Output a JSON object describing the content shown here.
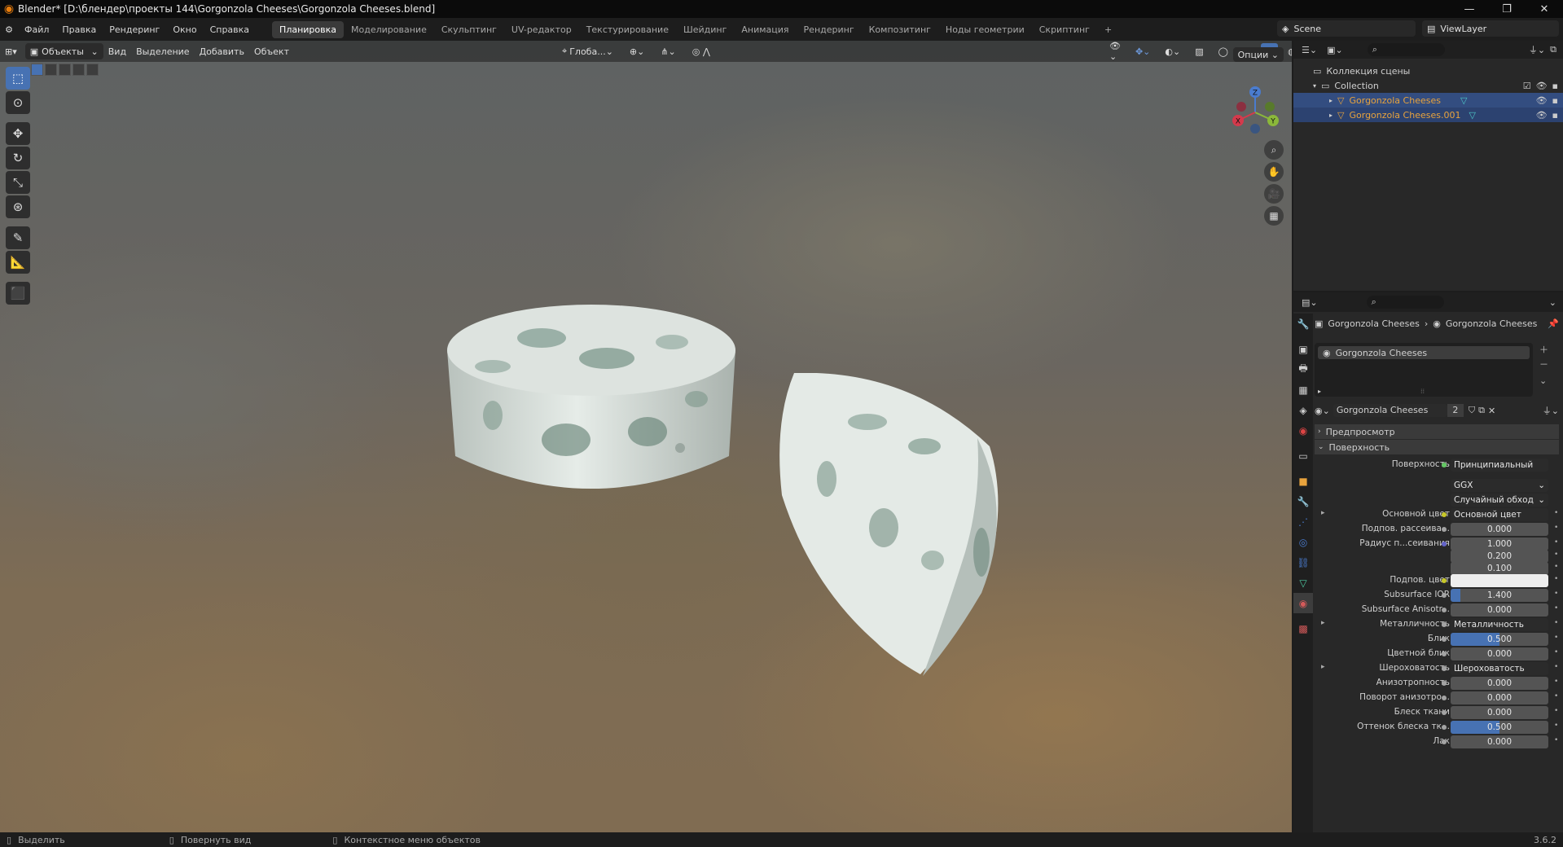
{
  "window": {
    "title": "Blender* [D:\\блендер\\проекты 144\\Gorgonzola Cheeses\\Gorgonzola Cheeses.blend]",
    "controls": [
      "—",
      "❐",
      "✕"
    ]
  },
  "menu": {
    "items": [
      "Файл",
      "Правка",
      "Рендеринг",
      "Окно",
      "Справка"
    ],
    "workspaces": [
      "Планировка",
      "Моделирование",
      "Скульптинг",
      "UV-редактор",
      "Текстурирование",
      "Шейдинг",
      "Анимация",
      "Рендеринг",
      "Композитинг",
      "Ноды геометрии",
      "Скриптинг"
    ],
    "active_workspace": "Планировка",
    "add_tab": "+",
    "scene": "Scene",
    "view_layer": "ViewLayer"
  },
  "viewport": {
    "mode": "Объекты",
    "menus": [
      "Вид",
      "Выделение",
      "Добавить",
      "Объект"
    ],
    "transform_orientation": "Глоба...",
    "options": "Опции",
    "gizmo": {
      "x": "X",
      "y": "Y",
      "z": "Z"
    }
  },
  "outliner": {
    "scene_collection": "Коллекция сцены",
    "collection": "Collection",
    "objects": [
      "Gorgonzola Cheeses",
      "Gorgonzola Cheeses.001"
    ]
  },
  "properties": {
    "breadcrumb": [
      "Gorgonzola Cheeses",
      "Gorgonzola Cheeses"
    ],
    "material_slot": "Gorgonzola Cheeses",
    "material_name": "Gorgonzola Cheeses",
    "user_count": "2",
    "sections": {
      "preview": "Предпросмотр",
      "surface": "Поверхность"
    },
    "surface_label": "Поверхность",
    "surface_value": "Принципиальный BSDF",
    "distribution": "GGX",
    "subsurface_method": "Случайный обход",
    "rows": [
      {
        "label": "Основной цвет",
        "value": "Основной цвет",
        "kind": "link",
        "dot": "yel"
      },
      {
        "label": "Подпов. рассеива...",
        "value": "0.000",
        "kind": "num",
        "dot": "grey",
        "fill": 0
      },
      {
        "label": "Радиус п...сеивания",
        "value": "1.000",
        "kind": "num",
        "dot": "blue",
        "fill": 0
      },
      {
        "label": "",
        "value": "0.200",
        "kind": "num",
        "dot": "",
        "fill": 0
      },
      {
        "label": "",
        "value": "0.100",
        "kind": "num",
        "dot": "",
        "fill": 0
      },
      {
        "label": "Подпов. цвет",
        "value": "",
        "kind": "color",
        "dot": "yel"
      },
      {
        "label": "Subsurface IOR",
        "value": "1.400",
        "kind": "num",
        "dot": "grey",
        "fill": 0.1
      },
      {
        "label": "Subsurface Anisotr...",
        "value": "0.000",
        "kind": "num",
        "dot": "grey",
        "fill": 0
      },
      {
        "label": "Металличность",
        "value": "Металличность",
        "kind": "link",
        "dot": "grey"
      },
      {
        "label": "Блик",
        "value": "0.500",
        "kind": "num",
        "dot": "grey",
        "fill": 0.5
      },
      {
        "label": "Цветной блик",
        "value": "0.000",
        "kind": "num",
        "dot": "grey",
        "fill": 0
      },
      {
        "label": "Шероховатость",
        "value": "Шероховатость",
        "kind": "link",
        "dot": "grey"
      },
      {
        "label": "Анизотропность",
        "value": "0.000",
        "kind": "num",
        "dot": "grey",
        "fill": 0
      },
      {
        "label": "Поворот анизотро...",
        "value": "0.000",
        "kind": "num",
        "dot": "grey",
        "fill": 0
      },
      {
        "label": "Блеск ткани",
        "value": "0.000",
        "kind": "num",
        "dot": "grey",
        "fill": 0
      },
      {
        "label": "Оттенок блеска тк...",
        "value": "0.500",
        "kind": "num",
        "dot": "grey",
        "fill": 0.5
      },
      {
        "label": "Лак",
        "value": "0.000",
        "kind": "num",
        "dot": "grey",
        "fill": 0
      }
    ]
  },
  "status": {
    "select": "Выделить",
    "rotate": "Повернуть вид",
    "context": "Контекстное меню объектов",
    "version": "3.6.2"
  },
  "colors": {
    "accent": "#4772b3",
    "selected_row": "#334d80",
    "object_orange": "#e8a33d",
    "blender_orange": "#e87d0d"
  }
}
